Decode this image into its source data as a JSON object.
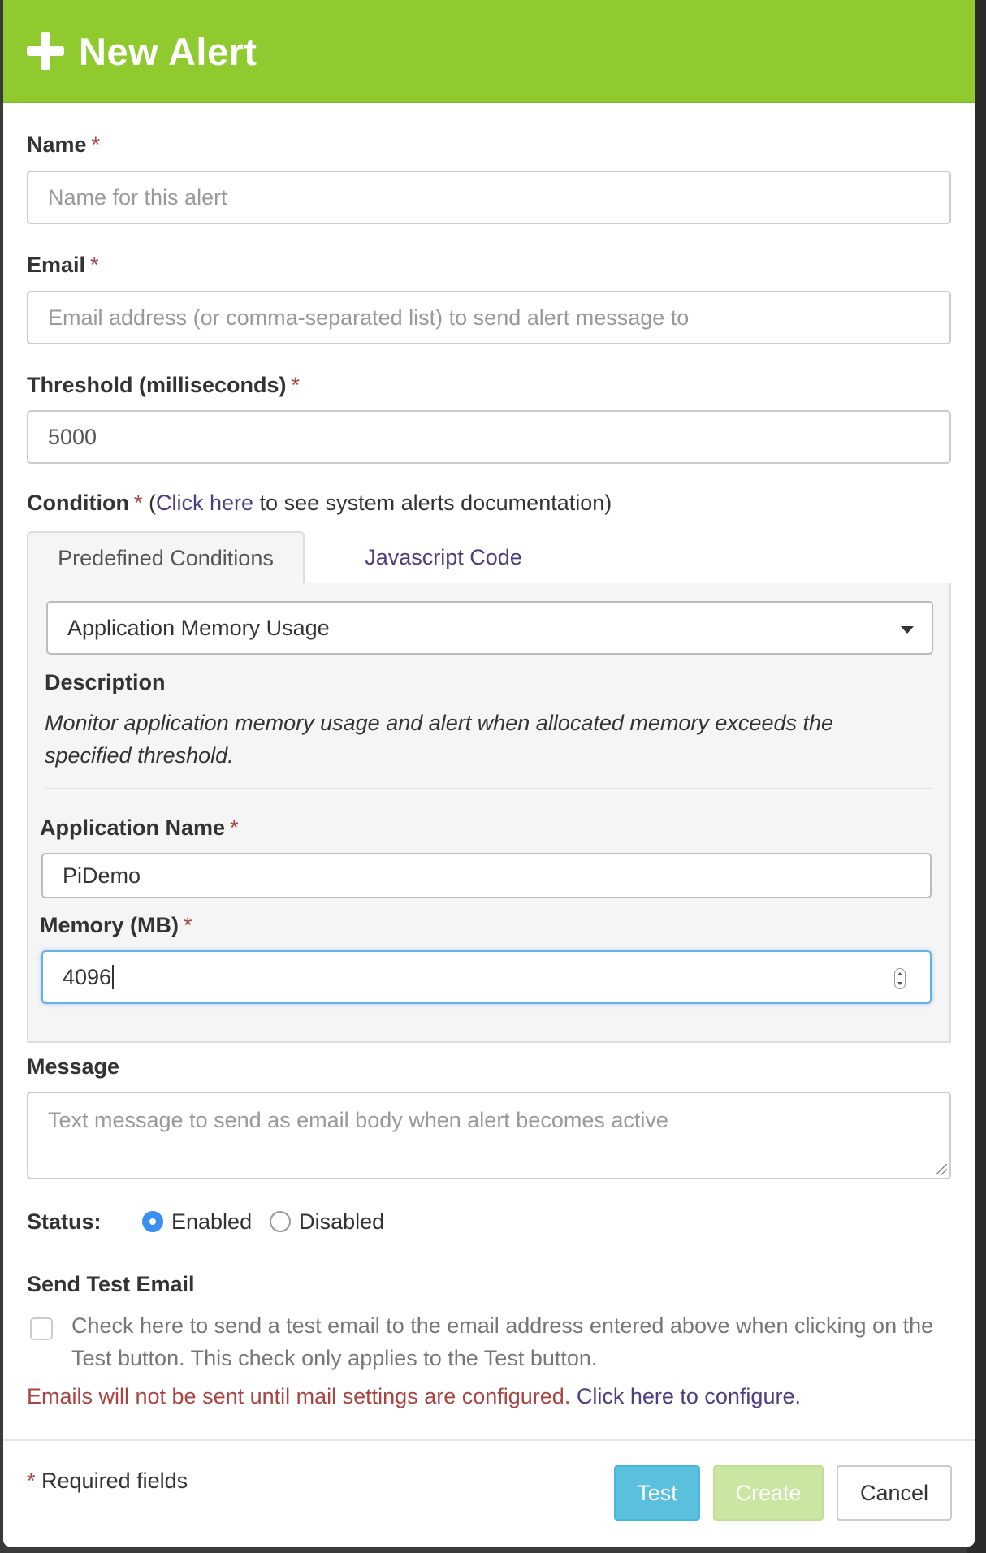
{
  "header": {
    "title": "New Alert"
  },
  "required_marker": "*",
  "fields": {
    "name": {
      "label": "Name",
      "placeholder": "Name for this alert",
      "value": ""
    },
    "email": {
      "label": "Email",
      "placeholder": "Email address (or comma-separated list) to send alert message to",
      "value": ""
    },
    "threshold": {
      "label": "Threshold (milliseconds)",
      "value": "5000"
    }
  },
  "condition": {
    "label": "Condition",
    "open_paren": "(",
    "link_text": "Click here",
    "after_link": " to see system alerts documentation)",
    "tabs": [
      {
        "label": "Predefined Conditions",
        "active": true
      },
      {
        "label": "Javascript Code",
        "active": false
      }
    ],
    "selected": "Application Memory Usage",
    "description_title": "Description",
    "description": "Monitor application memory usage and alert when allocated memory exceeds the specified threshold.",
    "app_name": {
      "label": "Application Name",
      "value": "PiDemo"
    },
    "memory": {
      "label": "Memory (MB)",
      "value": "4096"
    }
  },
  "message": {
    "label": "Message",
    "placeholder": "Text message to send as email body when alert becomes active"
  },
  "status": {
    "label": "Status:",
    "options": [
      {
        "label": "Enabled",
        "checked": true
      },
      {
        "label": "Disabled",
        "checked": false
      }
    ]
  },
  "test_email": {
    "label": "Send Test Email",
    "checkbox_text": "Check here to send a test email to the email address entered above when clicking on the Test button. This check only applies to the Test button.",
    "warning": "Emails will not be sent until mail settings are configured.",
    "configure_link": "Click here to configure."
  },
  "footer": {
    "required_note": "Required fields",
    "buttons": {
      "test": "Test",
      "create": "Create",
      "cancel": "Cancel"
    }
  },
  "colors": {
    "header": "#8fcb2f",
    "required": "#a94442",
    "link": "#4e3d80",
    "test_button": "#5bc0de",
    "create_button_disabled": "#c9e6a3",
    "focus": "#66afe9"
  }
}
